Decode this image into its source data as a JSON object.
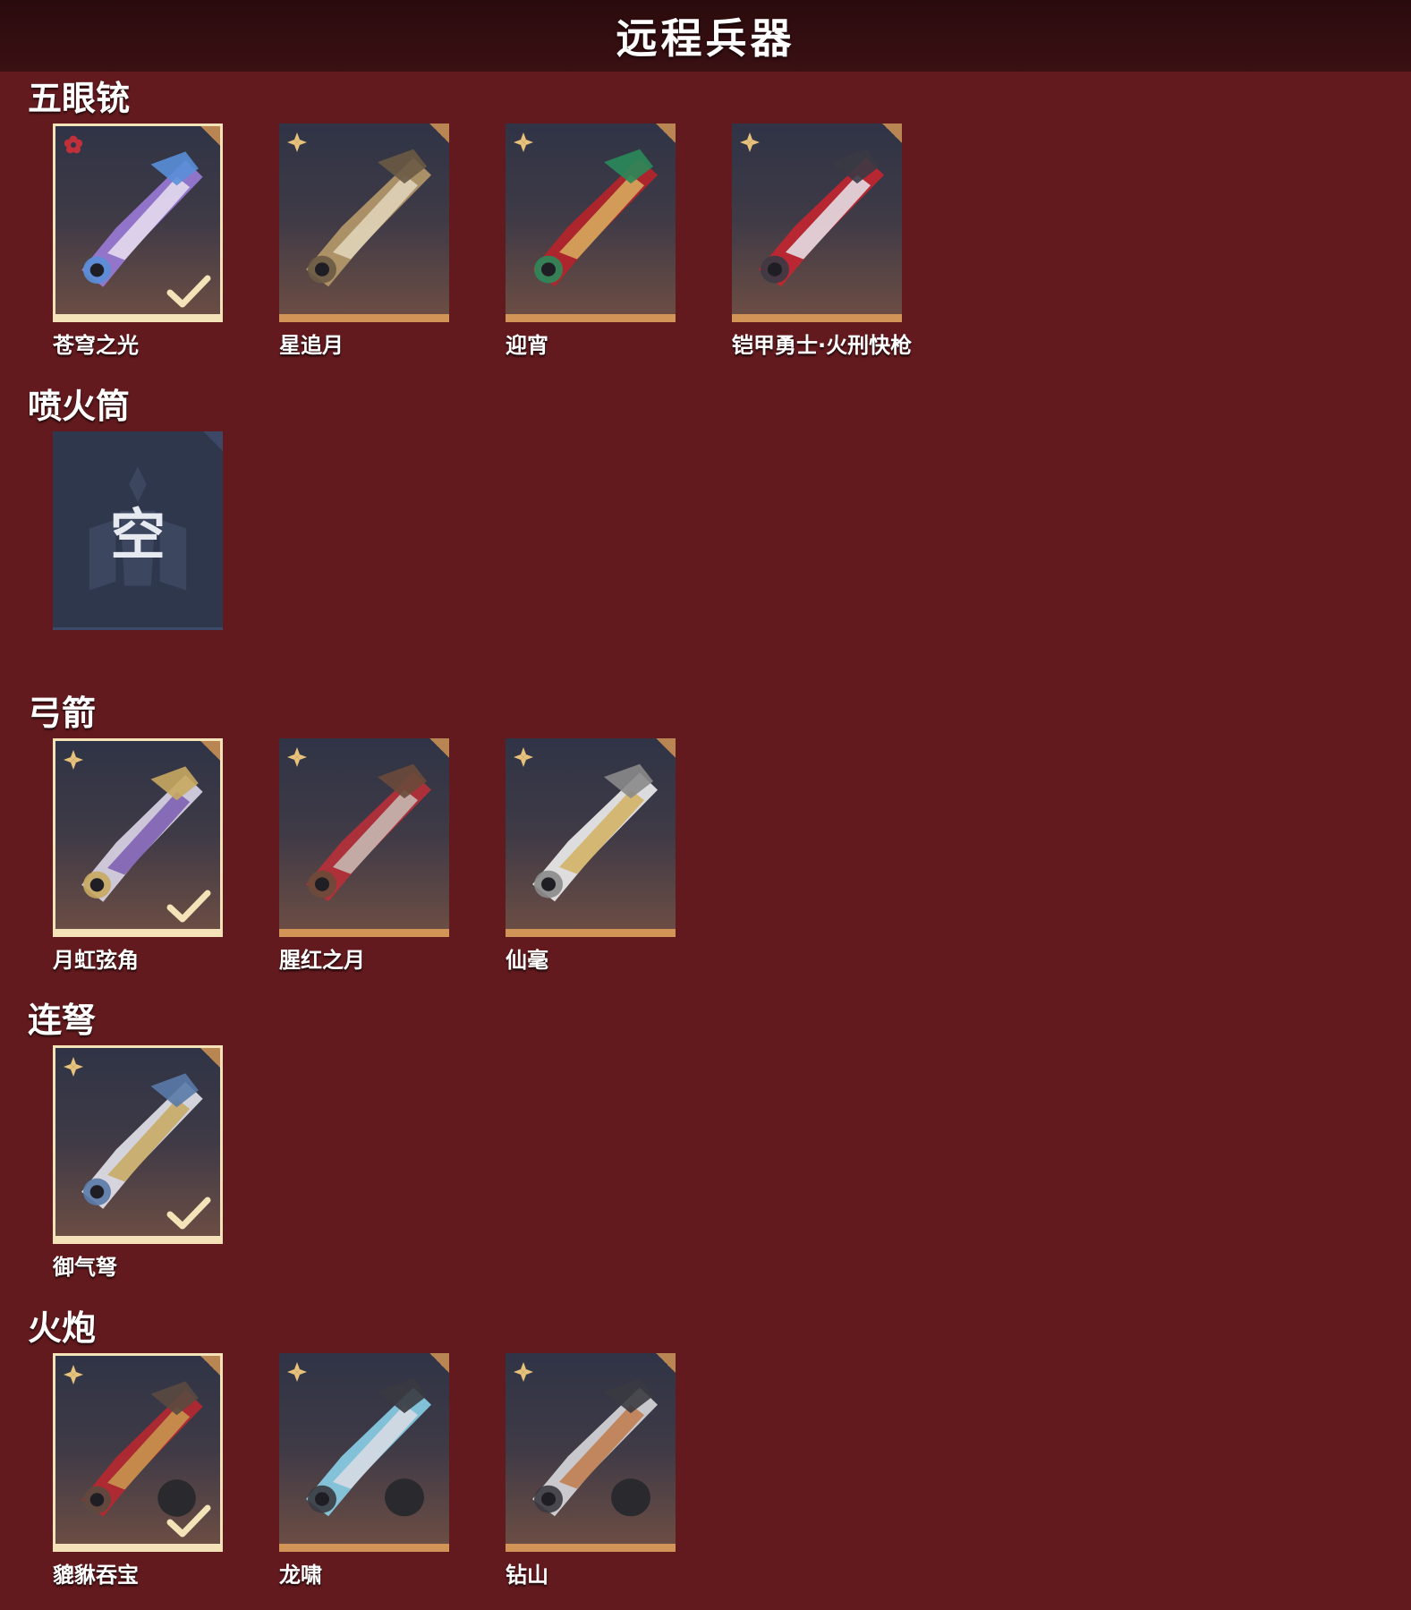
{
  "header": {
    "title": "远程兵器"
  },
  "colors": {
    "background": "#621a1e",
    "header": "#2a0b0d",
    "card_border": "#d39457",
    "equipped_border": "#f4e3b8",
    "empty_card": "#2f374d",
    "rarity_red": "#c0303a",
    "rarity_gold": "#e8c27a"
  },
  "sections": [
    {
      "title": "五眼铳",
      "items": [
        {
          "name": "苍穹之光",
          "rarity": "red-flower-icon",
          "equipped": true,
          "art": "purple-blue-gauntlet"
        },
        {
          "name": "星追月",
          "rarity": "gold-star-icon",
          "equipped": false,
          "art": "bronze-gatling"
        },
        {
          "name": "迎宵",
          "rarity": "gold-star-icon",
          "equipped": false,
          "art": "red-gold-gatling"
        },
        {
          "name": "铠甲勇士·火刑快枪",
          "rarity": "gold-star-icon",
          "equipped": false,
          "art": "red-armor-gun"
        }
      ]
    },
    {
      "title": "喷火筒",
      "items": [
        {
          "name": "",
          "empty_text": "空",
          "empty": true
        }
      ]
    },
    {
      "title": "弓箭",
      "items": [
        {
          "name": "月虹弦角",
          "rarity": "gold-star-icon",
          "equipped": true,
          "art": "silver-purple-bow"
        },
        {
          "name": "腥红之月",
          "rarity": "gold-star-icon",
          "equipped": false,
          "art": "red-quiver-bow"
        },
        {
          "name": "仙毫",
          "rarity": "gold-star-icon",
          "equipped": false,
          "art": "white-gold-bow"
        }
      ]
    },
    {
      "title": "连弩",
      "items": [
        {
          "name": "御气弩",
          "rarity": "gold-star-icon",
          "equipped": true,
          "art": "silver-crossbow"
        }
      ]
    },
    {
      "title": "火炮",
      "items": [
        {
          "name": "貔貅吞宝",
          "rarity": "gold-star-icon",
          "equipped": true,
          "art": "red-gold-cannon"
        },
        {
          "name": "龙啸",
          "rarity": "gold-star-icon",
          "equipped": false,
          "art": "dragon-cannon"
        },
        {
          "name": "钻山",
          "rarity": "gold-star-icon",
          "equipped": false,
          "art": "silver-cannon"
        }
      ]
    }
  ]
}
